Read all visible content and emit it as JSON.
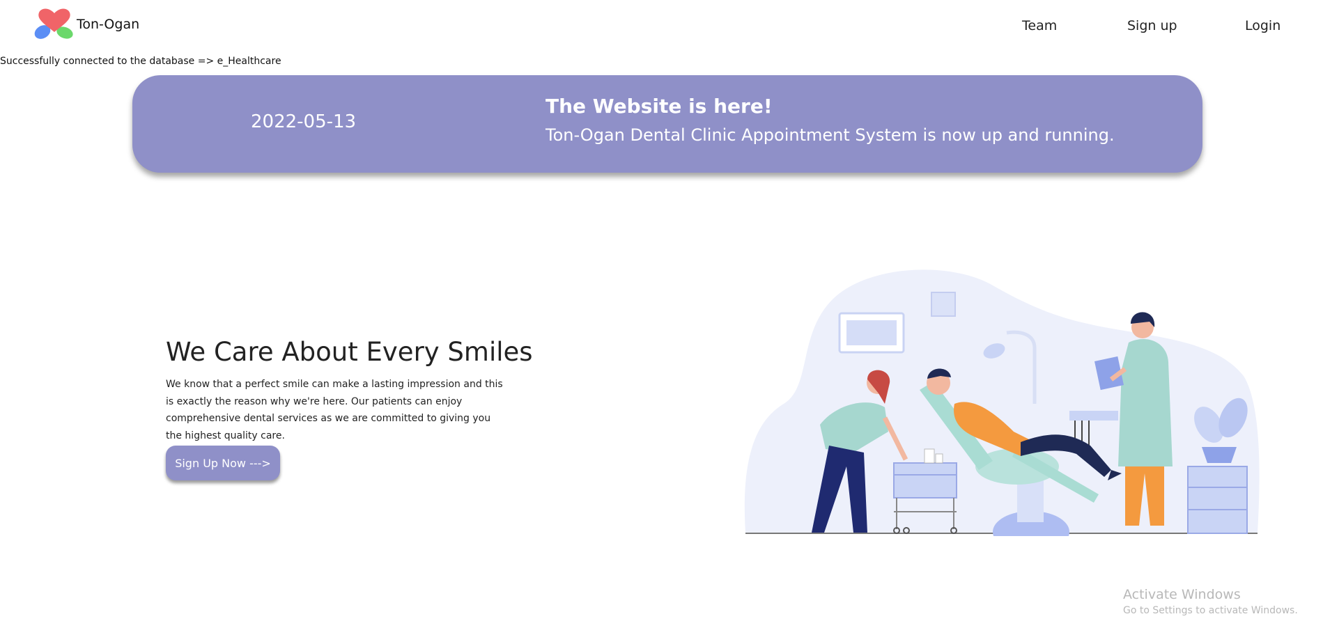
{
  "nav": {
    "brand": "Ton-Ogan",
    "links": [
      {
        "label": "Team"
      },
      {
        "label": "Sign up"
      },
      {
        "label": "Login"
      }
    ]
  },
  "status": {
    "message": "Successfully connected to the database => e_Healthcare"
  },
  "banner": {
    "date": "2022-05-13",
    "title": "The Website is here!",
    "text": "Ton-Ogan Dental Clinic Appointment System is now up and running.",
    "color": "#8f90c8"
  },
  "hero": {
    "heading": "We Care About Every Smiles",
    "body": "We know that a perfect smile can make a lasting impression and this is exactly the reason why we're here. Our patients can enjoy comprehensive dental services as we are committed to giving you the highest quality care.",
    "button_label": "Sign Up Now --->"
  },
  "illustration": {
    "subject": "dental-clinic-scene"
  },
  "watermark": {
    "title": "Activate Windows",
    "subtitle": "Go to Settings to activate Windows."
  },
  "colors": {
    "accent": "#8f90c8",
    "heart_red": "#f06468",
    "leaf_blue": "#5b8ef5",
    "leaf_green": "#6bd86b"
  }
}
